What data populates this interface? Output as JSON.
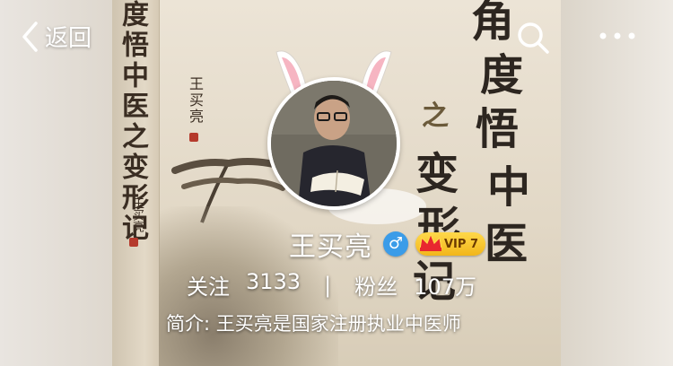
{
  "nav": {
    "back_label": "返回",
    "search_icon": "search-icon",
    "more_icon": "more-icon"
  },
  "cover": {
    "spine_title": "度悟中医之变形记",
    "spine_author": "王买亮",
    "cover_author": "王买亮",
    "title_chars": [
      "角",
      "度",
      "悟",
      "中",
      "医",
      "之",
      "变",
      "形",
      "记"
    ]
  },
  "profile": {
    "avatar_icon": "avatar-photo",
    "decoration": "bunny-ears",
    "name": "王买亮",
    "gender_symbol": "♂",
    "vip_label": "VIP 7",
    "follow_label": "关注",
    "follow_count": "3133",
    "separator": "|",
    "fans_label": "粉丝",
    "fans_count": "107万",
    "bio": "简介: 王买亮是国家注册执业中医师"
  },
  "colors": {
    "gender_badge": "#3b9ce8",
    "vip_gold": "#f2b61b",
    "text": "#ffffff"
  }
}
